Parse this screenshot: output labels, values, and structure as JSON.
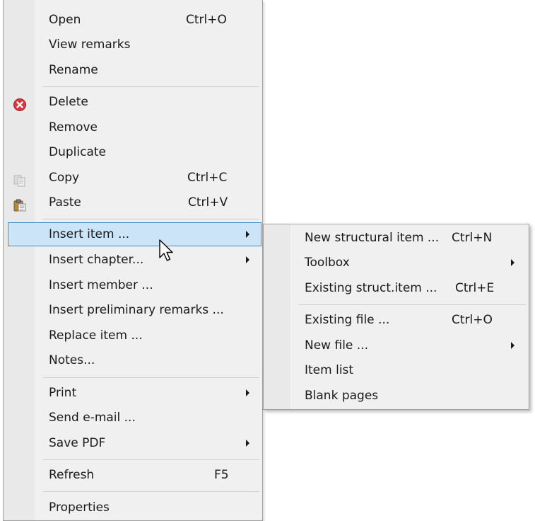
{
  "main_menu": {
    "items": [
      {
        "label": "Open",
        "shortcut": "Ctrl+O"
      },
      {
        "label": "View remarks"
      },
      {
        "label": "Rename"
      },
      {
        "label": "Delete",
        "icon": "delete-icon"
      },
      {
        "label": "Remove"
      },
      {
        "label": "Duplicate"
      },
      {
        "label": "Copy",
        "shortcut": "Ctrl+C",
        "icon": "copy-icon"
      },
      {
        "label": "Paste",
        "shortcut": "Ctrl+V",
        "icon": "paste-icon"
      },
      {
        "label": "Insert item ...",
        "submenu": true,
        "highlighted": true
      },
      {
        "label": "Insert chapter...",
        "submenu": true
      },
      {
        "label": "Insert member ..."
      },
      {
        "label": "Insert preliminary remarks ..."
      },
      {
        "label": "Replace item ..."
      },
      {
        "label": "Notes..."
      },
      {
        "label": "Print",
        "submenu": true
      },
      {
        "label": "Send e-mail ..."
      },
      {
        "label": "Save PDF",
        "submenu": true
      },
      {
        "label": "Refresh",
        "shortcut": "F5"
      },
      {
        "label": "Properties"
      }
    ]
  },
  "sub_menu": {
    "items": [
      {
        "label": "New structural item ...",
        "shortcut": "Ctrl+N"
      },
      {
        "label": "Toolbox",
        "submenu": true
      },
      {
        "label": "Existing struct.item ...",
        "shortcut": "Ctrl+E"
      },
      {
        "label": "Existing file ...",
        "shortcut": "Ctrl+O"
      },
      {
        "label": "New file ...",
        "submenu": true
      },
      {
        "label": "Item list"
      },
      {
        "label": "Blank pages"
      }
    ]
  },
  "colors": {
    "highlight_bg": "#cce4f7",
    "highlight_border": "#3f91d1",
    "menu_bg": "#f0f0f0",
    "delete_icon": "#d9363e"
  }
}
